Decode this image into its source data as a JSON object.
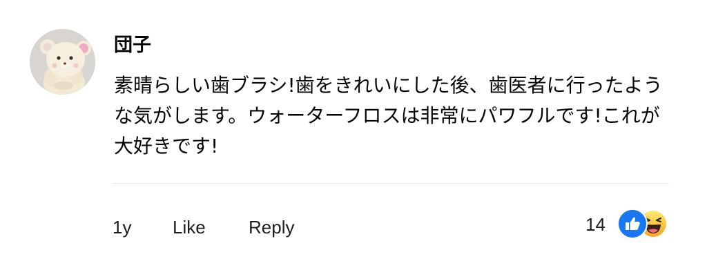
{
  "comment": {
    "author": "団子",
    "avatar_icon": "bear-plush-avatar-icon",
    "text": "素晴らしい歯ブラシ!歯をきれいにした後、歯医者に行ったような気がします。ウォーターフロスは非常にパワフルです!これが大好きです!"
  },
  "actions": {
    "time": "1y",
    "like_label": "Like",
    "reply_label": "Reply"
  },
  "reactions": {
    "count": "14",
    "icons": [
      "like-reaction-icon",
      "haha-reaction-icon"
    ],
    "colors": {
      "like": "#1877f2",
      "haha": "#f7b125"
    }
  }
}
